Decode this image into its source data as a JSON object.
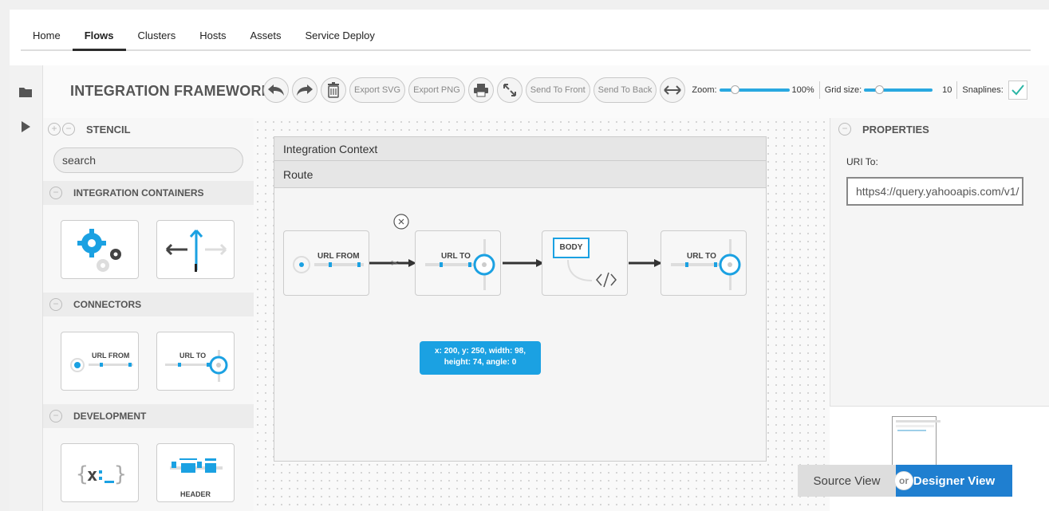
{
  "nav": {
    "tabs": [
      "Home",
      "Flows",
      "Clusters",
      "Hosts",
      "Assets",
      "Service Deploy"
    ],
    "active": "Flows"
  },
  "app": {
    "title": "INTEGRATION FRAMEWORK"
  },
  "toolbar": {
    "export_svg": "Export SVG",
    "export_png": "Export PNG",
    "send_front": "Send To Front",
    "send_back": "Send To Back",
    "zoom_label": "Zoom:",
    "zoom_value": "100%",
    "grid_label": "Grid size:",
    "grid_value": "10",
    "snaplines_label": "Snaplines:",
    "snaplines_checked": true
  },
  "stencil": {
    "title": "STENCIL",
    "search_value": "search",
    "groups": [
      "INTEGRATION CONTAINERS",
      "CONNECTORS",
      "DEVELOPMENT"
    ],
    "connector_from": "URL FROM",
    "connector_to": "URL TO",
    "header_label": "HEADER"
  },
  "canvas": {
    "context_title": "Integration Context",
    "route_title": "Route",
    "nodes": [
      "URL FROM",
      "URL TO",
      "BODY",
      "URL TO"
    ],
    "tooltip": "x: 200, y: 250, width: 98, height: 74, angle: 0"
  },
  "properties": {
    "title": "PROPERTIES",
    "uri_label": "URI To:",
    "uri_value": "https4://query.yahooapis.com/v1/"
  },
  "views": {
    "source": "Source View",
    "or": "or",
    "designer": "Designer View"
  },
  "colors": {
    "accent": "#29a8e0",
    "primary": "#1f7fd0",
    "tooltip": "#1ba1e2"
  }
}
